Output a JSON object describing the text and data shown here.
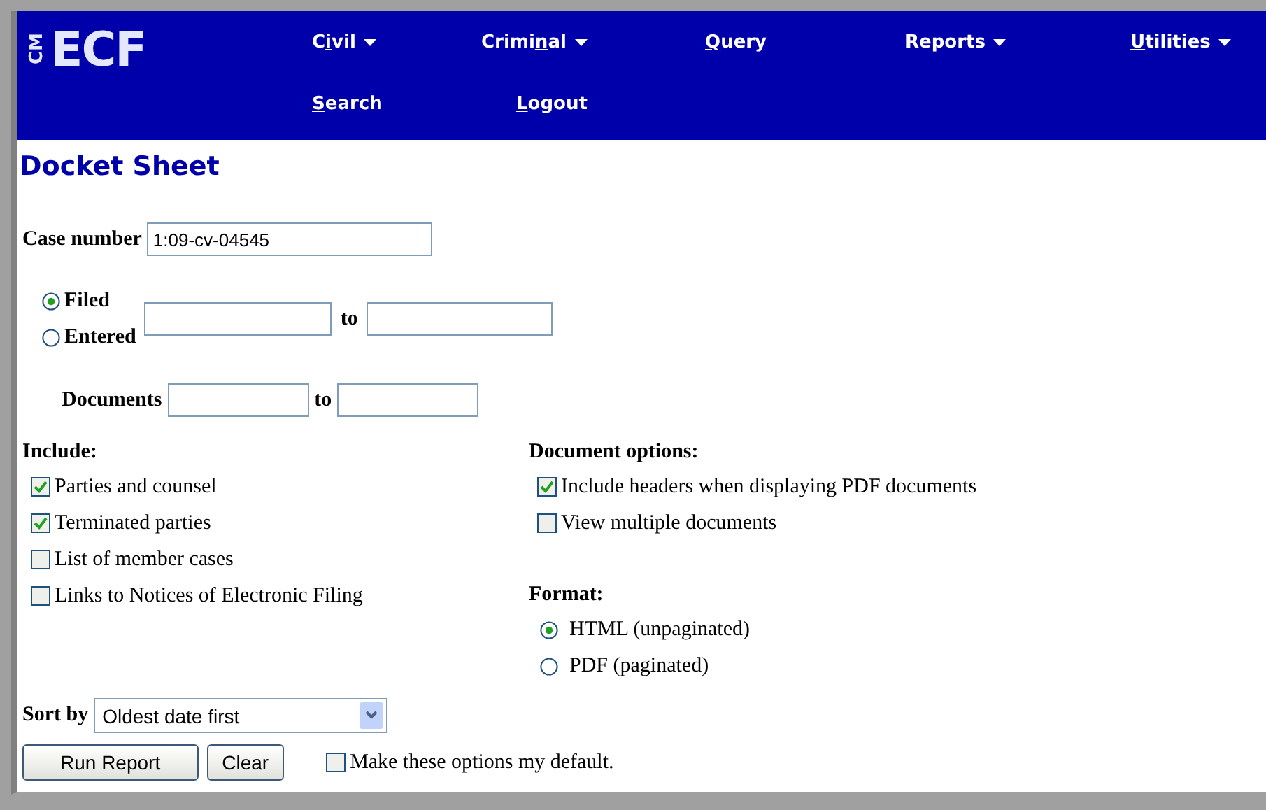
{
  "logo": {
    "small": "CM",
    "large": "ECF"
  },
  "menu_rows": [
    [
      {
        "pre": "C",
        "key": "i",
        "post": "vil",
        "has_menu": true
      },
      {
        "pre": "Crimi",
        "key": "n",
        "post": "al",
        "has_menu": true
      },
      {
        "key": "Q",
        "post": "uery",
        "has_menu": false
      },
      {
        "pre": "Reports",
        "has_menu": true
      },
      {
        "key": "U",
        "post": "tilities",
        "has_menu": true
      }
    ],
    [
      {
        "key": "S",
        "post": "earch",
        "has_menu": false
      },
      {
        "key": "L",
        "post": "ogout",
        "has_menu": false
      }
    ]
  ],
  "page_title": "Docket Sheet",
  "case_number": {
    "label": "Case number",
    "value": "1:09-cv-04545"
  },
  "date_type": [
    {
      "label": "Filed",
      "selected": true
    },
    {
      "label": "Entered",
      "selected": false
    }
  ],
  "date_to": "to",
  "documents": {
    "label": "Documents",
    "to": "to"
  },
  "include": {
    "heading": "Include:",
    "items": [
      {
        "label": "Parties and counsel",
        "checked": true
      },
      {
        "label": "Terminated parties",
        "checked": true
      },
      {
        "label": "List of member cases",
        "checked": false
      },
      {
        "label": "Links to Notices of Electronic Filing",
        "checked": false
      }
    ]
  },
  "document_options": {
    "heading": "Document options:",
    "items": [
      {
        "label": "Include headers when displaying PDF documents",
        "checked": true
      },
      {
        "label": "View multiple documents",
        "checked": false
      }
    ]
  },
  "format": {
    "heading": "Format:",
    "options": [
      {
        "label": "HTML (unpaginated)",
        "selected": true
      },
      {
        "label": "PDF (paginated)",
        "selected": false
      }
    ]
  },
  "sort_by": {
    "label": "Sort by",
    "value": "Oldest date first"
  },
  "buttons": [
    "Run Report",
    "Clear"
  ],
  "default_option": {
    "label": "Make these options my default.",
    "checked": false
  }
}
